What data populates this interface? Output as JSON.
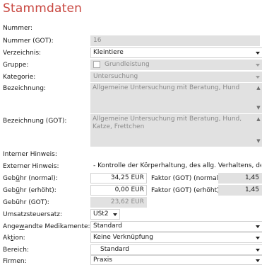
{
  "title": "Stammdaten",
  "labels": {
    "nummer": "Nummer:",
    "nummer_got": "Nummer (GOT):",
    "verzeichnis": "Verzeichnis:",
    "gruppe": "Gruppe:",
    "kategorie": "Kategorie:",
    "bezeichnung": "Bezeichnung:",
    "bezeichnung_got": "Bezeichnung (GOT):",
    "interner_hinweis": "Interner Hinweis:",
    "externer_hinweis": "Externer Hinweis:",
    "gebuehr_normal": "Gebühr (normal):",
    "gebuehr_erhoeht": "Gebühr (erhöht):",
    "gebuehr_got": "Gebühr (GOT):",
    "umsatzsteuersatz": "Umsatzsteuersatz:",
    "medikamente": "Angewandte Medikamente:",
    "aktion": "Aktion:",
    "bereich": "Bereich:",
    "firmen": "Firmen:"
  },
  "values": {
    "nummer": "",
    "nummer_got": "16",
    "verzeichnis": "Kleintiere",
    "gruppe": "Grundleistung",
    "kategorie": "Untersuchung",
    "bezeichnung": "Allgemeine Untersuchung mit Beratung, Hund",
    "bezeichnung_got": "Allgemeine Untersuchung mit Beratung, Hund, Katze, Frettchen",
    "interner_hinweis": "",
    "externer_hinweis": "- Kontrolle der Körperhaltung, des allg. Verhaltens, des Ernährungs",
    "gebuehr_normal": "34,25 EUR",
    "gebuehr_erhoeht": "0,00 EUR",
    "gebuehr_got": "23,62 EUR",
    "faktor_normal_label": "Faktor (GOT) (normal):",
    "faktor_normal": "1,45",
    "faktor_erhoeht_label": "Faktor (GOT) (erhöht):",
    "faktor_erhoeht": "1,45",
    "umsatzsteuersatz": "USt2",
    "medikamente": "Standard",
    "aktion": "Keine Verknüpfung",
    "bereich": "Standard",
    "firmen": "Praxis"
  },
  "icons": {
    "dropdown": "chevron-down-icon",
    "scroll_up": "scroll-up-icon",
    "scroll_down": "scroll-down-icon"
  },
  "colors": {
    "title": "#c8463f",
    "readonly": "#e1e1e1"
  }
}
